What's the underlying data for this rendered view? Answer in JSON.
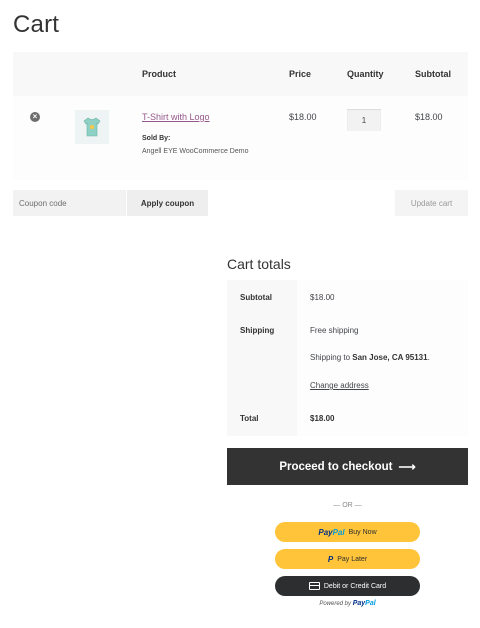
{
  "page": {
    "title": "Cart"
  },
  "cart_table": {
    "headers": {
      "product": "Product",
      "price": "Price",
      "quantity": "Quantity",
      "subtotal": "Subtotal"
    },
    "rows": [
      {
        "remove_icon": "close-circle-icon",
        "thumbnail_icon": "tshirt-icon",
        "product_name": "T-Shirt with Logo",
        "sold_by_label": "Sold By:",
        "vendor": "Angell EYE WooCommerce Demo",
        "price": "$18.00",
        "quantity": "1",
        "subtotal": "$18.00"
      }
    ]
  },
  "coupon": {
    "placeholder": "Coupon code",
    "apply_label": "Apply coupon",
    "update_label": "Update cart"
  },
  "totals": {
    "title": "Cart totals",
    "subtotal_label": "Subtotal",
    "subtotal_value": "$18.00",
    "shipping_label": "Shipping",
    "shipping_method": "Free shipping",
    "shipping_to_prefix": "Shipping to",
    "shipping_to_location": "San Jose, CA 95131",
    "shipping_to_suffix": ".",
    "change_address": "Change address",
    "total_label": "Total",
    "total_value": "$18.00"
  },
  "checkout": {
    "label": "Proceed to checkout",
    "arrow": "⟶"
  },
  "separator": "— OR —",
  "paypal": {
    "brand_a": "Pay",
    "brand_b": "Pal",
    "buy_now": "Buy Now",
    "pay_later": "Pay Later",
    "card": "Debit or Credit Card",
    "powered_by": "Powered by"
  },
  "colors": {
    "accent": "#96588a",
    "dark": "#333333",
    "paypal_yellow": "#ffc439",
    "paypal_navy": "#003087",
    "paypal_blue": "#009cde"
  }
}
